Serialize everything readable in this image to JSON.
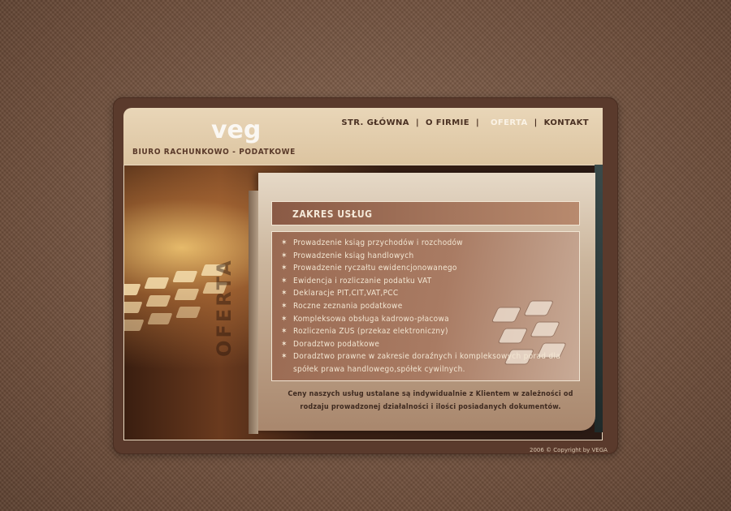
{
  "brand": {
    "logo_text": "vega",
    "tagline": "BIURO RACHUNKOWO - PODATKOWE",
    "logo_icon": "vega-logo"
  },
  "nav": {
    "items": [
      {
        "label": "STR. GŁÓWNA",
        "active": false
      },
      {
        "label": "O FIRMIE",
        "active": false
      },
      {
        "label": "OFERTA",
        "active": true
      },
      {
        "label": "KONTAKT",
        "active": false
      }
    ],
    "separator": "|"
  },
  "content": {
    "section_title": "ZAKRES USŁUG",
    "side_label": "OFERTA",
    "bullet_icon": "star-icon",
    "services": [
      "Prowadzenie ksiąg przychodów i rozchodów",
      "Prowadzenie ksiąg handlowych",
      "Prowadzenie ryczałtu ewidencjonowanego",
      "Ewidencja i rozliczanie podatku VAT",
      "Deklaracje PIT,CIT,VAT,PCC",
      "Roczne zeznania podatkowe",
      "Kompleksowa obsługa kadrowo-płacowa",
      "Rozliczenia ZUS (przekaz elektroniczny)",
      "Doradztwo podatkowe",
      "Doradztwo prawne w zakresie doraźnych i kompleksowych porad dla spółek prawa handlowego,spółek cywilnych."
    ],
    "note": "Ceny naszych usług ustalane są indywidualnie z Klientem w zależności od rodzaju prowadzonej działalności i ilości posiadanych dokumentów."
  },
  "footer": {
    "copyright": "2006 © Copyright by VEGA"
  },
  "colors": {
    "accent": "#8a5a45",
    "header_bg": "#e3ceac",
    "text_light": "#f3e6d2"
  }
}
